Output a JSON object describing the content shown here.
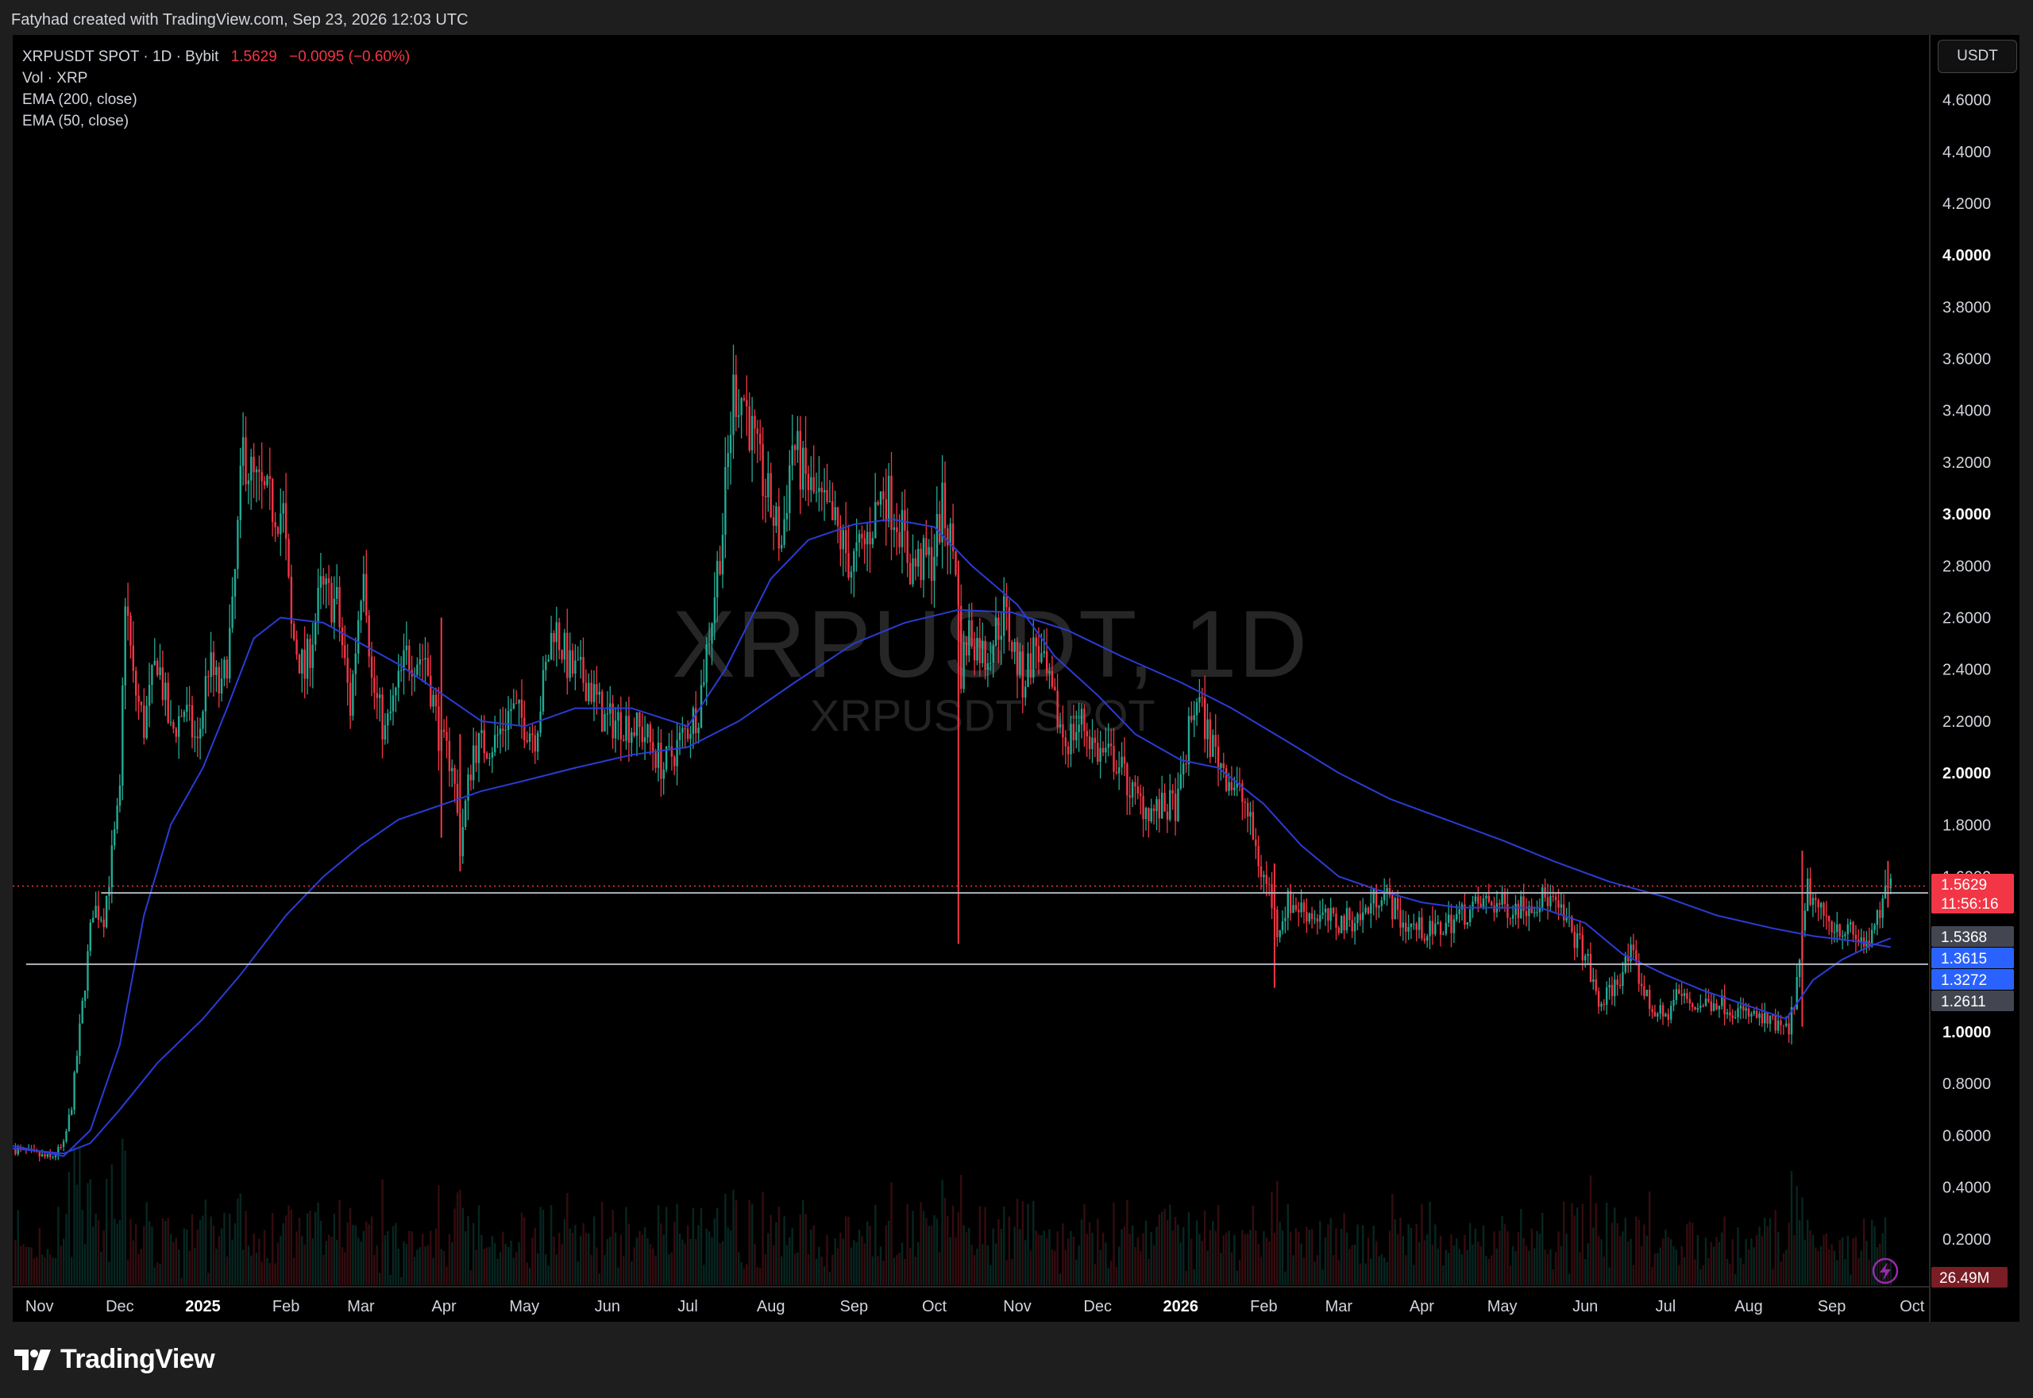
{
  "header": {
    "text": "Fatyhad created with TradingView.com, Sep 23, 2026 12:03 UTC"
  },
  "legend": {
    "symbol": "XRPUSDT SPOT · 1D · Bybit",
    "price": "1.5629",
    "change": "−0.0095 (−0.60%)",
    "vol": "Vol · XRP",
    "ema200": "EMA (200, close)",
    "ema50": "EMA (50, close)"
  },
  "watermark": {
    "line1": "XRPUSDT, 1D",
    "line2": "XRPUSDT SPOT"
  },
  "currency": "USDT",
  "footer": {
    "brand": "TradingView"
  },
  "colors": {
    "up": "#22ab94",
    "down": "#f23645",
    "ema": "#2a3cd6",
    "grid_bg": "#000000",
    "label_red": "#f23645",
    "label_blue": "#2962ff",
    "label_gray": "#434651"
  },
  "chart_data": {
    "type": "line",
    "ylim": [
      0,
      4.7
    ],
    "y_ticks": [
      {
        "v": 4.6,
        "label": "4.6000",
        "bold": false
      },
      {
        "v": 4.4,
        "label": "4.4000",
        "bold": false
      },
      {
        "v": 4.2,
        "label": "4.2000",
        "bold": false
      },
      {
        "v": 4.0,
        "label": "4.0000",
        "bold": true
      },
      {
        "v": 3.8,
        "label": "3.8000",
        "bold": false
      },
      {
        "v": 3.6,
        "label": "3.6000",
        "bold": false
      },
      {
        "v": 3.4,
        "label": "3.4000",
        "bold": false
      },
      {
        "v": 3.2,
        "label": "3.2000",
        "bold": false
      },
      {
        "v": 3.0,
        "label": "3.0000",
        "bold": true
      },
      {
        "v": 2.8,
        "label": "2.8000",
        "bold": false
      },
      {
        "v": 2.6,
        "label": "2.6000",
        "bold": false
      },
      {
        "v": 2.4,
        "label": "2.4000",
        "bold": false
      },
      {
        "v": 2.2,
        "label": "2.2000",
        "bold": false
      },
      {
        "v": 2.0,
        "label": "2.0000",
        "bold": true
      },
      {
        "v": 1.8,
        "label": "1.8000",
        "bold": false
      },
      {
        "v": 1.6,
        "label": "1.6000",
        "bold": false
      },
      {
        "v": 1.0,
        "label": "1.0000",
        "bold": true
      },
      {
        "v": 0.8,
        "label": "0.8000",
        "bold": false
      },
      {
        "v": 0.6,
        "label": "0.6000",
        "bold": false
      },
      {
        "v": 0.4,
        "label": "0.4000",
        "bold": false
      },
      {
        "v": 0.2,
        "label": "0.2000",
        "bold": false
      }
    ],
    "x_ticks": [
      {
        "d": "2024-11-01",
        "label": "Nov",
        "bold": false
      },
      {
        "d": "2024-12-01",
        "label": "Dec",
        "bold": false
      },
      {
        "d": "2025-01-01",
        "label": "2025",
        "bold": true
      },
      {
        "d": "2025-02-01",
        "label": "Feb",
        "bold": false
      },
      {
        "d": "2025-03-01",
        "label": "Mar",
        "bold": false
      },
      {
        "d": "2025-04-01",
        "label": "Apr",
        "bold": false
      },
      {
        "d": "2025-05-01",
        "label": "May",
        "bold": false
      },
      {
        "d": "2025-06-01",
        "label": "Jun",
        "bold": false
      },
      {
        "d": "2025-07-01",
        "label": "Jul",
        "bold": false
      },
      {
        "d": "2025-08-01",
        "label": "Aug",
        "bold": false
      },
      {
        "d": "2025-09-01",
        "label": "Sep",
        "bold": false
      },
      {
        "d": "2025-10-01",
        "label": "Oct",
        "bold": false
      },
      {
        "d": "2025-11-01",
        "label": "Nov",
        "bold": false
      },
      {
        "d": "2025-12-01",
        "label": "Dec",
        "bold": false
      },
      {
        "d": "2026-01-01",
        "label": "2026",
        "bold": true
      },
      {
        "d": "2026-02-01",
        "label": "Feb",
        "bold": false
      },
      {
        "d": "2026-03-01",
        "label": "Mar",
        "bold": false
      },
      {
        "d": "2026-04-01",
        "label": "Apr",
        "bold": false
      },
      {
        "d": "2026-05-01",
        "label": "May",
        "bold": false
      },
      {
        "d": "2026-06-01",
        "label": "Jun",
        "bold": false
      },
      {
        "d": "2026-07-01",
        "label": "Jul",
        "bold": false
      },
      {
        "d": "2026-08-01",
        "label": "Aug",
        "bold": false
      },
      {
        "d": "2026-09-01",
        "label": "Sep",
        "bold": false
      },
      {
        "d": "2026-10-01",
        "label": "Oct",
        "bold": false
      }
    ],
    "x_range": [
      "2024-10-22",
      "2026-10-07"
    ],
    "price_path": [
      [
        "2024-10-22",
        0.55
      ],
      [
        "2024-11-05",
        0.51
      ],
      [
        "2024-11-10",
        0.56
      ],
      [
        "2024-11-13",
        0.72
      ],
      [
        "2024-11-17",
        1.1
      ],
      [
        "2024-11-21",
        1.48
      ],
      [
        "2024-11-25",
        1.45
      ],
      [
        "2024-12-01",
        1.9
      ],
      [
        "2024-12-03",
        2.7
      ],
      [
        "2024-12-06",
        2.35
      ],
      [
        "2024-12-10",
        2.18
      ],
      [
        "2024-12-15",
        2.45
      ],
      [
        "2024-12-20",
        2.15
      ],
      [
        "2024-12-25",
        2.25
      ],
      [
        "2024-12-30",
        2.1
      ],
      [
        "2025-01-03",
        2.42
      ],
      [
        "2025-01-08",
        2.3
      ],
      [
        "2025-01-12",
        2.6
      ],
      [
        "2025-01-16",
        3.25
      ],
      [
        "2025-01-20",
        3.12
      ],
      [
        "2025-01-25",
        3.05
      ],
      [
        "2025-01-31",
        3.0
      ],
      [
        "2025-02-03",
        2.55
      ],
      [
        "2025-02-08",
        2.38
      ],
      [
        "2025-02-14",
        2.7
      ],
      [
        "2025-02-20",
        2.65
      ],
      [
        "2025-02-25",
        2.25
      ],
      [
        "2025-03-02",
        2.85
      ],
      [
        "2025-03-05",
        2.35
      ],
      [
        "2025-03-10",
        2.15
      ],
      [
        "2025-03-18",
        2.45
      ],
      [
        "2025-03-25",
        2.45
      ],
      [
        "2025-03-31",
        2.1
      ],
      [
        "2025-04-04",
        2.05
      ],
      [
        "2025-04-07",
        1.72
      ],
      [
        "2025-04-12",
        2.1
      ],
      [
        "2025-04-20",
        2.12
      ],
      [
        "2025-04-26",
        2.25
      ],
      [
        "2025-05-05",
        2.15
      ],
      [
        "2025-05-12",
        2.58
      ],
      [
        "2025-05-18",
        2.4
      ],
      [
        "2025-05-25",
        2.35
      ],
      [
        "2025-05-31",
        2.2
      ],
      [
        "2025-06-07",
        2.2
      ],
      [
        "2025-06-15",
        2.15
      ],
      [
        "2025-06-22",
        2.02
      ],
      [
        "2025-06-28",
        2.12
      ],
      [
        "2025-07-05",
        2.25
      ],
      [
        "2025-07-10",
        2.62
      ],
      [
        "2025-07-14",
        2.95
      ],
      [
        "2025-07-18",
        3.48
      ],
      [
        "2025-07-22",
        3.45
      ],
      [
        "2025-07-27",
        3.2
      ],
      [
        "2025-08-01",
        3.02
      ],
      [
        "2025-08-05",
        2.88
      ],
      [
        "2025-08-09",
        3.28
      ],
      [
        "2025-08-13",
        3.15
      ],
      [
        "2025-08-18",
        3.05
      ],
      [
        "2025-08-25",
        2.95
      ],
      [
        "2025-08-31",
        2.8
      ],
      [
        "2025-09-05",
        2.88
      ],
      [
        "2025-09-12",
        3.1
      ],
      [
        "2025-09-18",
        2.97
      ],
      [
        "2025-09-22",
        2.8
      ],
      [
        "2025-09-30",
        2.82
      ],
      [
        "2025-10-04",
        3.02
      ],
      [
        "2025-10-09",
        2.82
      ],
      [
        "2025-10-11",
        2.4
      ],
      [
        "2025-10-14",
        2.55
      ],
      [
        "2025-10-20",
        2.45
      ],
      [
        "2025-10-27",
        2.62
      ],
      [
        "2025-11-03",
        2.35
      ],
      [
        "2025-11-08",
        2.5
      ],
      [
        "2025-11-14",
        2.28
      ],
      [
        "2025-11-19",
        2.12
      ],
      [
        "2025-11-25",
        2.2
      ],
      [
        "2025-12-01",
        2.08
      ],
      [
        "2025-12-08",
        2.05
      ],
      [
        "2025-12-15",
        1.9
      ],
      [
        "2025-12-22",
        1.85
      ],
      [
        "2025-12-31",
        1.88
      ],
      [
        "2026-01-04",
        2.15
      ],
      [
        "2026-01-07",
        2.3
      ],
      [
        "2026-01-12",
        2.12
      ],
      [
        "2026-01-18",
        2.0
      ],
      [
        "2026-01-25",
        1.88
      ],
      [
        "2026-01-31",
        1.62
      ],
      [
        "2026-02-03",
        1.55
      ],
      [
        "2026-02-06",
        1.4
      ],
      [
        "2026-02-10",
        1.5
      ],
      [
        "2026-02-20",
        1.45
      ],
      [
        "2026-03-01",
        1.42
      ],
      [
        "2026-03-10",
        1.45
      ],
      [
        "2026-03-17",
        1.55
      ],
      [
        "2026-03-25",
        1.42
      ],
      [
        "2026-04-05",
        1.38
      ],
      [
        "2026-04-15",
        1.45
      ],
      [
        "2026-04-25",
        1.5
      ],
      [
        "2026-05-05",
        1.48
      ],
      [
        "2026-05-12",
        1.5
      ],
      [
        "2026-05-18",
        1.52
      ],
      [
        "2026-05-25",
        1.42
      ],
      [
        "2026-06-01",
        1.3
      ],
      [
        "2026-06-06",
        1.1
      ],
      [
        "2026-06-12",
        1.18
      ],
      [
        "2026-06-18",
        1.3
      ],
      [
        "2026-06-25",
        1.1
      ],
      [
        "2026-07-01",
        1.05
      ],
      [
        "2026-07-05",
        1.15
      ],
      [
        "2026-07-12",
        1.1
      ],
      [
        "2026-07-20",
        1.12
      ],
      [
        "2026-07-28",
        1.08
      ],
      [
        "2026-08-05",
        1.05
      ],
      [
        "2026-08-12",
        1.02
      ],
      [
        "2026-08-16",
        1.0
      ],
      [
        "2026-08-20",
        1.25
      ],
      [
        "2026-08-23",
        1.55
      ],
      [
        "2026-08-28",
        1.45
      ],
      [
        "2026-09-05",
        1.4
      ],
      [
        "2026-09-12",
        1.35
      ],
      [
        "2026-09-16",
        1.35
      ],
      [
        "2026-09-20",
        1.5
      ],
      [
        "2026-09-23",
        1.5629
      ]
    ],
    "wicks": [
      {
        "d": "2025-10-10",
        "high": 2.82,
        "low": 1.34
      },
      {
        "d": "2025-03-31",
        "high": 2.6,
        "low": 1.75
      },
      {
        "d": "2025-04-07",
        "high": 2.15,
        "low": 1.62
      },
      {
        "d": "2026-02-05",
        "high": 1.65,
        "low": 1.17
      },
      {
        "d": "2026-08-21",
        "high": 1.7,
        "low": 1.02
      },
      {
        "d": "2026-09-22",
        "high": 1.66,
        "low": 1.48
      }
    ],
    "ema50_path": [
      [
        "2024-10-22",
        0.56
      ],
      [
        "2024-11-10",
        0.52
      ],
      [
        "2024-11-20",
        0.62
      ],
      [
        "2024-12-01",
        0.95
      ],
      [
        "2024-12-10",
        1.45
      ],
      [
        "2024-12-20",
        1.8
      ],
      [
        "2025-01-01",
        2.02
      ],
      [
        "2025-01-10",
        2.25
      ],
      [
        "2025-01-20",
        2.52
      ],
      [
        "2025-01-30",
        2.6
      ],
      [
        "2025-02-15",
        2.58
      ],
      [
        "2025-03-01",
        2.5
      ],
      [
        "2025-03-15",
        2.42
      ],
      [
        "2025-04-01",
        2.3
      ],
      [
        "2025-04-15",
        2.2
      ],
      [
        "2025-05-01",
        2.18
      ],
      [
        "2025-05-20",
        2.25
      ],
      [
        "2025-06-10",
        2.25
      ],
      [
        "2025-07-01",
        2.18
      ],
      [
        "2025-07-15",
        2.4
      ],
      [
        "2025-08-01",
        2.75
      ],
      [
        "2025-08-15",
        2.9
      ],
      [
        "2025-09-01",
        2.96
      ],
      [
        "2025-09-15",
        2.98
      ],
      [
        "2025-10-01",
        2.95
      ],
      [
        "2025-10-15",
        2.8
      ],
      [
        "2025-11-01",
        2.65
      ],
      [
        "2025-11-15",
        2.45
      ],
      [
        "2025-12-01",
        2.3
      ],
      [
        "2025-12-15",
        2.15
      ],
      [
        "2026-01-01",
        2.05
      ],
      [
        "2026-01-15",
        2.02
      ],
      [
        "2026-02-01",
        1.88
      ],
      [
        "2026-02-15",
        1.72
      ],
      [
        "2026-03-01",
        1.6
      ],
      [
        "2026-03-15",
        1.55
      ],
      [
        "2026-04-01",
        1.5
      ],
      [
        "2026-04-15",
        1.48
      ],
      [
        "2026-05-01",
        1.48
      ],
      [
        "2026-05-15",
        1.48
      ],
      [
        "2026-06-01",
        1.42
      ],
      [
        "2026-06-15",
        1.3
      ],
      [
        "2026-07-01",
        1.22
      ],
      [
        "2026-07-15",
        1.16
      ],
      [
        "2026-08-01",
        1.1
      ],
      [
        "2026-08-15",
        1.05
      ],
      [
        "2026-08-25",
        1.2
      ],
      [
        "2026-09-05",
        1.28
      ],
      [
        "2026-09-15",
        1.33
      ],
      [
        "2026-09-23",
        1.3615
      ]
    ],
    "ema200_path": [
      [
        "2024-10-22",
        0.55
      ],
      [
        "2024-11-10",
        0.53
      ],
      [
        "2024-11-20",
        0.57
      ],
      [
        "2024-12-01",
        0.7
      ],
      [
        "2024-12-15",
        0.88
      ],
      [
        "2025-01-01",
        1.05
      ],
      [
        "2025-01-15",
        1.22
      ],
      [
        "2025-02-01",
        1.45
      ],
      [
        "2025-02-15",
        1.6
      ],
      [
        "2025-03-01",
        1.72
      ],
      [
        "2025-03-15",
        1.82
      ],
      [
        "2025-04-01",
        1.88
      ],
      [
        "2025-04-15",
        1.93
      ],
      [
        "2025-05-01",
        1.97
      ],
      [
        "2025-05-20",
        2.02
      ],
      [
        "2025-06-10",
        2.07
      ],
      [
        "2025-07-01",
        2.1
      ],
      [
        "2025-07-20",
        2.2
      ],
      [
        "2025-08-10",
        2.35
      ],
      [
        "2025-09-01",
        2.5
      ],
      [
        "2025-09-20",
        2.58
      ],
      [
        "2025-10-10",
        2.63
      ],
      [
        "2025-10-30",
        2.62
      ],
      [
        "2025-11-20",
        2.55
      ],
      [
        "2025-12-10",
        2.45
      ],
      [
        "2026-01-01",
        2.35
      ],
      [
        "2026-01-20",
        2.25
      ],
      [
        "2026-02-10",
        2.12
      ],
      [
        "2026-03-01",
        2.0
      ],
      [
        "2026-03-20",
        1.9
      ],
      [
        "2026-04-10",
        1.82
      ],
      [
        "2026-05-01",
        1.74
      ],
      [
        "2026-05-20",
        1.66
      ],
      [
        "2026-06-10",
        1.58
      ],
      [
        "2026-07-01",
        1.52
      ],
      [
        "2026-07-20",
        1.45
      ],
      [
        "2026-08-10",
        1.4
      ],
      [
        "2026-08-25",
        1.37
      ],
      [
        "2026-09-10",
        1.35
      ],
      [
        "2026-09-23",
        1.3272
      ]
    ],
    "hlines": [
      {
        "v": 1.5368,
        "from": "2024-11-24"
      },
      {
        "v": 1.2611,
        "from": "2024-10-27"
      }
    ],
    "last_price": 1.5629,
    "price_labels": [
      {
        "v": 1.5629,
        "text": "1.5629",
        "sub": "11:56:16",
        "color": "red"
      },
      {
        "v": 1.5368,
        "text": "1.5368",
        "color": "gray"
      },
      {
        "v": 1.3615,
        "text": "1.3615",
        "color": "blue"
      },
      {
        "v": 1.3272,
        "text": "1.3272",
        "color": "blue"
      },
      {
        "v": 1.2611,
        "text": "1.2611",
        "color": "gray"
      }
    ],
    "volume_label": "26.49M"
  }
}
